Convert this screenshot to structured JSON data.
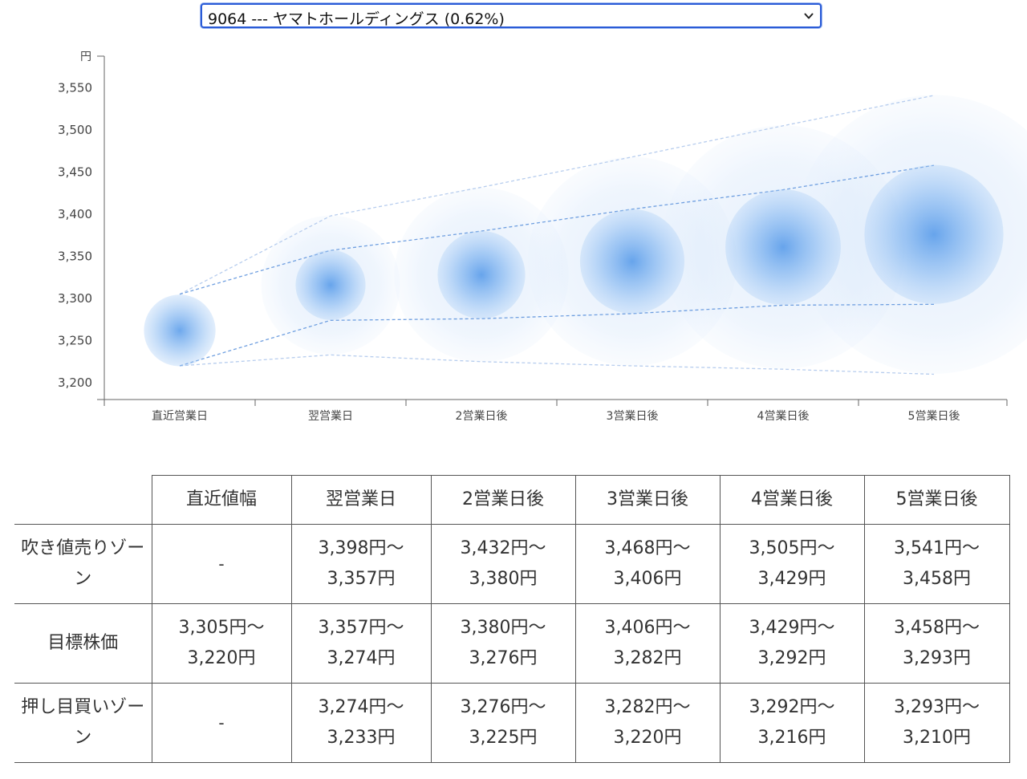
{
  "selector": {
    "selected_label": "9064 --- ヤマトホールディングス (0.62%)"
  },
  "chart_data": {
    "type": "scatter",
    "unit_label": "円",
    "categories": [
      "直近営業日",
      "翌営業日",
      "2営業日後",
      "3営業日後",
      "4営業日後",
      "5営業日後"
    ],
    "y_ticks": [
      3200,
      3250,
      3300,
      3350,
      3400,
      3450,
      3500,
      3550
    ],
    "ylim": [
      3180,
      3580
    ],
    "series": [
      {
        "values": [
          3262,
          3316,
          3328,
          3344,
          3361,
          3376
        ]
      }
    ],
    "upper_zone_top": [
      3305,
      3398,
      3432,
      3468,
      3505,
      3541
    ],
    "target_top": [
      3305,
      3357,
      3380,
      3406,
      3429,
      3458
    ],
    "target_bottom": [
      3220,
      3274,
      3276,
      3282,
      3292,
      3293
    ],
    "lower_zone_bottom": [
      3220,
      3233,
      3225,
      3220,
      3216,
      3210
    ],
    "colors": {
      "bubble": "#4a90e2",
      "line_inner": "#6f9fe0",
      "line_outer": "#b7cdee",
      "axis": "#666666"
    }
  },
  "table": {
    "headers": [
      "",
      "直近値幅",
      "翌営業日",
      "2営業日後",
      "3営業日後",
      "4営業日後",
      "5営業日後"
    ],
    "rows": [
      {
        "label": "吹き値売りゾーン",
        "cells": [
          [
            "-"
          ],
          [
            "3,398円〜",
            "3,357円"
          ],
          [
            "3,432円〜",
            "3,380円"
          ],
          [
            "3,468円〜",
            "3,406円"
          ],
          [
            "3,505円〜",
            "3,429円"
          ],
          [
            "3,541円〜",
            "3,458円"
          ]
        ]
      },
      {
        "label": "目標株価",
        "cells": [
          [
            "3,305円〜",
            "3,220円"
          ],
          [
            "3,357円〜",
            "3,274円"
          ],
          [
            "3,380円〜",
            "3,276円"
          ],
          [
            "3,406円〜",
            "3,282円"
          ],
          [
            "3,429円〜",
            "3,292円"
          ],
          [
            "3,458円〜",
            "3,293円"
          ]
        ]
      },
      {
        "label": "押し目買いゾーン",
        "cells": [
          [
            "-"
          ],
          [
            "3,274円〜",
            "3,233円"
          ],
          [
            "3,276円〜",
            "3,225円"
          ],
          [
            "3,282円〜",
            "3,220円"
          ],
          [
            "3,292円〜",
            "3,216円"
          ],
          [
            "3,293円〜",
            "3,210円"
          ]
        ]
      }
    ]
  }
}
